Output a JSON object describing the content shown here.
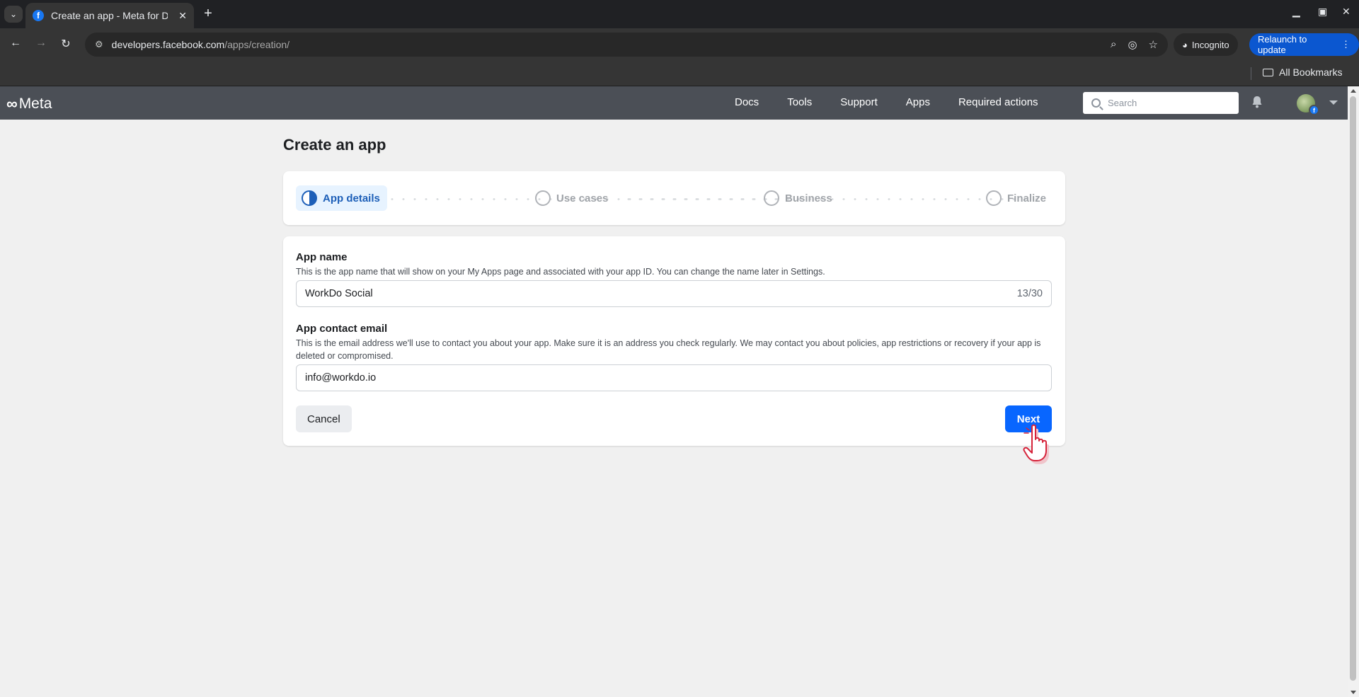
{
  "browser": {
    "tab_title": "Create an app - Meta for Developers",
    "tab_favicon": "facebook-icon",
    "url_host": "developers.facebook.com",
    "url_path": "/apps/creation/",
    "incognito_label": "Incognito",
    "relaunch_label": "Relaunch to update",
    "all_bookmarks_label": "All Bookmarks"
  },
  "metanav": {
    "logo_text": "Meta",
    "links": [
      "Docs",
      "Tools",
      "Support",
      "Apps",
      "Required actions"
    ],
    "search_placeholder": "Search"
  },
  "page": {
    "title": "Create an app",
    "steps": [
      {
        "label": "App details",
        "state": "active"
      },
      {
        "label": "Use cases",
        "state": "pending"
      },
      {
        "label": "Business",
        "state": "pending"
      },
      {
        "label": "Finalize",
        "state": "pending"
      }
    ]
  },
  "form": {
    "app_name_label": "App name",
    "app_name_help": "This is the app name that will show on your My Apps page and associated with your app ID. You can change the name later in Settings.",
    "app_name_value": "WorkDo Social",
    "app_name_count": "13/30",
    "email_label": "App contact email",
    "email_help": "This is the email address we'll use to contact you about your app. Make sure it is an address you check regularly. We may contact you about policies, app restrictions or recovery if your app is deleted or compromised.",
    "email_value": "info@workdo.io",
    "cancel_label": "Cancel",
    "next_label": "Next"
  },
  "colors": {
    "primary_button": "#0866ff",
    "active_step": "#1d5fb8",
    "nav_bg": "#4b4f56"
  }
}
